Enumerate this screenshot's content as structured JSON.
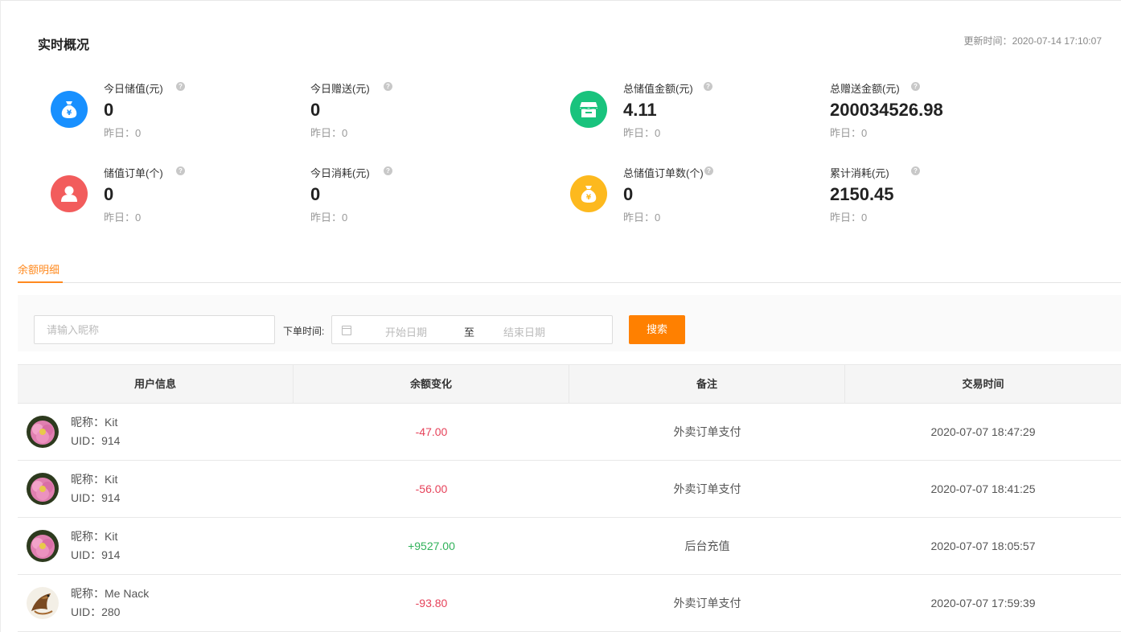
{
  "header": {
    "title": "实时概况",
    "update_label": "更新时间：",
    "update_time": "2020-07-14 17:10:07"
  },
  "stats": [
    {
      "label": "今日储值(元)",
      "value": "0",
      "yesterday": "昨日：0",
      "icon": "money-bag-icon",
      "color": "#1890ff"
    },
    {
      "label": "今日赠送(元)",
      "value": "0",
      "yesterday": "昨日：0"
    },
    {
      "label": "总储值金额(元)",
      "value": "4.11",
      "yesterday": "昨日：0",
      "icon": "store-icon",
      "color": "#19c37d"
    },
    {
      "label": "总赠送金额(元)",
      "value": "200034526.98",
      "yesterday": "昨日：0"
    },
    {
      "label": "储值订单(个)",
      "value": "0",
      "yesterday": "昨日：0",
      "icon": "user-icon",
      "color": "#f25c5c"
    },
    {
      "label": "今日消耗(元)",
      "value": "0",
      "yesterday": "昨日：0"
    },
    {
      "label": "总储值订单数(个)",
      "value": "0",
      "yesterday": "昨日：0",
      "icon": "money-bag-icon",
      "color": "#fdb91e"
    },
    {
      "label": "累计消耗(元)",
      "value": "2150.45",
      "yesterday": "昨日：0"
    }
  ],
  "help_glyph": "?",
  "tabs": [
    {
      "label": "余额明细",
      "active": true
    }
  ],
  "filter": {
    "nickname_placeholder": "请输入昵称",
    "date_label": "下单时间:",
    "start_placeholder": "开始日期",
    "to": "至",
    "end_placeholder": "结束日期",
    "search_label": "搜索"
  },
  "table": {
    "columns": [
      "用户信息",
      "余额变化",
      "备注",
      "交易时间"
    ],
    "rows": [
      {
        "nickname": "昵称：Kit",
        "uid": "UID：914",
        "change": "-47.00",
        "change_type": "neg",
        "note": "外卖订单支付",
        "time": "2020-07-07 18:47:29",
        "avatar": "flower"
      },
      {
        "nickname": "昵称：Kit",
        "uid": "UID：914",
        "change": "-56.00",
        "change_type": "neg",
        "note": "外卖订单支付",
        "time": "2020-07-07 18:41:25",
        "avatar": "flower"
      },
      {
        "nickname": "昵称：Kit",
        "uid": "UID：914",
        "change": "+9527.00",
        "change_type": "pos",
        "note": "后台充值",
        "time": "2020-07-07 18:05:57",
        "avatar": "flower"
      },
      {
        "nickname": "昵称：Me Nack",
        "uid": "UID：280",
        "change": "-93.80",
        "change_type": "neg",
        "note": "外卖订单支付",
        "time": "2020-07-07 17:59:39",
        "avatar": "bird"
      }
    ]
  },
  "colors": {
    "accent": "#ff8000",
    "negative": "#e6425a",
    "positive": "#31b25a"
  }
}
